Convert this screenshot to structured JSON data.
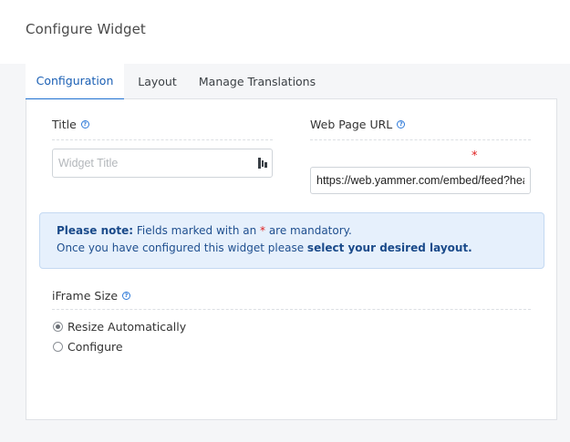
{
  "header": {
    "title": "Configure Widget"
  },
  "tabs": [
    {
      "label": "Configuration",
      "active": true
    },
    {
      "label": "Layout",
      "active": false
    },
    {
      "label": "Manage Translations",
      "active": false
    }
  ],
  "form": {
    "title_field": {
      "label": "Title",
      "placeholder": "Widget Title",
      "value": "",
      "icon": "translate-icon"
    },
    "url_field": {
      "label": "Web Page URL",
      "required_marker": "*",
      "value": "https://web.yammer.com/embed/feed?header=false"
    },
    "note": {
      "prefix_bold": "Please note:",
      "line1_before_star": " Fields marked with an ",
      "star": "*",
      "line1_after_star": " are mandatory.",
      "line2_text": "Once you have configured this widget please ",
      "line2_bold": "select your desired layout."
    },
    "iframe_size": {
      "label": "iFrame Size",
      "options": [
        {
          "label": "Resize Automatically",
          "checked": true
        },
        {
          "label": "Configure",
          "checked": false
        }
      ]
    }
  },
  "colors": {
    "accent": "#1e6fd0",
    "required": "#e02020",
    "note_bg": "#e6f0fc"
  }
}
